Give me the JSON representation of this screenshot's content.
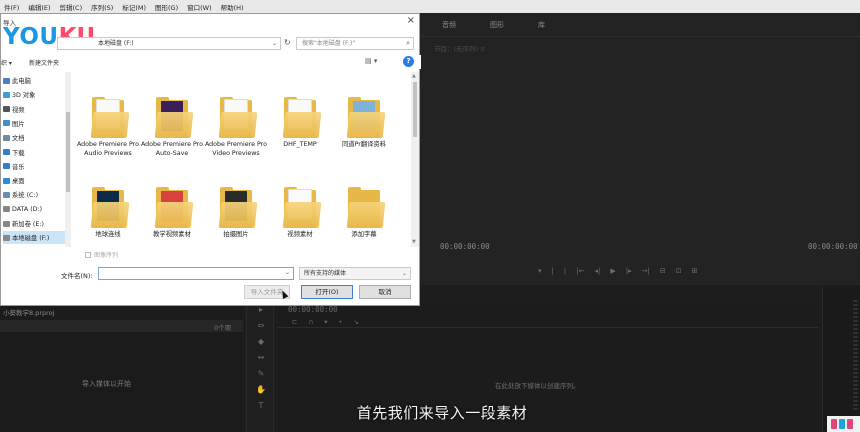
{
  "menubar": {
    "items": [
      "件(F)",
      "编辑(E)",
      "剪辑(C)",
      "序列(S)",
      "标记(M)",
      "图形(G)",
      "窗口(W)",
      "帮助(H)"
    ]
  },
  "source_panel": {
    "tabs": [
      "音频",
      "图形",
      "库"
    ],
    "subhead": "节目：(无序列) ≡",
    "timecode_left": "00:00:00:00",
    "timecode_right": "00:00:00:00",
    "controls": [
      "▾",
      "|",
      "|",
      "|←",
      "◂|",
      "▶",
      "|▸",
      "→|",
      "⊟",
      "⊡",
      "⊞"
    ]
  },
  "project_panel": {
    "name": "小葵教学8.prproj",
    "count": "0个项",
    "placeholder": "导入媒体以开始"
  },
  "timeline_panel": {
    "timecode": "00:00:00:00",
    "placeholder": "在此处放下媒体以创建序列。",
    "icons": [
      "⊏",
      "∩",
      "▾",
      "•",
      "↘"
    ]
  },
  "tools": [
    "▸",
    "⇔",
    "◆",
    "↔",
    "✎",
    "✋",
    "T"
  ],
  "subtitle": "首先我们来导入一段素材",
  "dialog": {
    "title": "导入",
    "close": "×",
    "watermark_a": "YOU",
    "watermark_b": "KU",
    "address": "本地磁盘 (F:)",
    "refresh": "↻",
    "search_placeholder": "搜索\"本地磁盘 (F:)\"",
    "organize": "织 ▾",
    "new_folder": "新建文件夹",
    "view_icon": "▤ ▾",
    "help": "?",
    "nav_items": [
      {
        "label": "此电脑",
        "icon": "pc-icon",
        "color": "#4a7fc1"
      },
      {
        "label": "3D 对象",
        "icon": "cube-icon",
        "color": "#3e9bd6"
      },
      {
        "label": "视频",
        "icon": "video-icon",
        "color": "#555555"
      },
      {
        "label": "图片",
        "icon": "picture-icon",
        "color": "#3d8fd1"
      },
      {
        "label": "文档",
        "icon": "document-icon",
        "color": "#6d8aa8"
      },
      {
        "label": "下载",
        "icon": "download-icon",
        "color": "#2f7fd1"
      },
      {
        "label": "音乐",
        "icon": "music-icon",
        "color": "#2f7fd1"
      },
      {
        "label": "桌面",
        "icon": "desktop-icon",
        "color": "#2f8ad9"
      },
      {
        "label": "系统 (C:)",
        "icon": "drive-icon",
        "color": "#6b8fb3"
      },
      {
        "label": "DATA (D:)",
        "icon": "drive-icon",
        "color": "#888888"
      },
      {
        "label": "新加卷 (E:)",
        "icon": "drive-icon",
        "color": "#888888"
      },
      {
        "label": "本地磁盘 (F:)",
        "icon": "drive-icon",
        "color": "#888888"
      }
    ],
    "files": [
      {
        "label": "Adobe Premiere Pro Audio Previews",
        "thumb": "paper"
      },
      {
        "label": "Adobe Premiere Pro Auto-Save",
        "thumb": "#3a1f5c"
      },
      {
        "label": "Adobe Premiere Pro Video Previews",
        "thumb": "paper"
      },
      {
        "label": "DHF_TEMP",
        "thumb": "paper"
      },
      {
        "label": "同道Pr翻译资料",
        "thumb": "#7db3d9"
      },
      {
        "label": "地球连线",
        "thumb": "#0e2a4a"
      },
      {
        "label": "教学视频素材",
        "thumb": "#d94141"
      },
      {
        "label": "拍摄图片",
        "thumb": "#2b2b2b"
      },
      {
        "label": "视频素材",
        "thumb": "paper"
      },
      {
        "label": "添加字幕",
        "thumb": "none"
      }
    ],
    "sequence_checkbox": "图像序列",
    "filename_label": "文件名(N):",
    "filename_value": "",
    "filter": "所有支持的媒体",
    "import_folder_button": "导入文件夹",
    "open_button": "打开(O)",
    "cancel_button": "取消"
  }
}
